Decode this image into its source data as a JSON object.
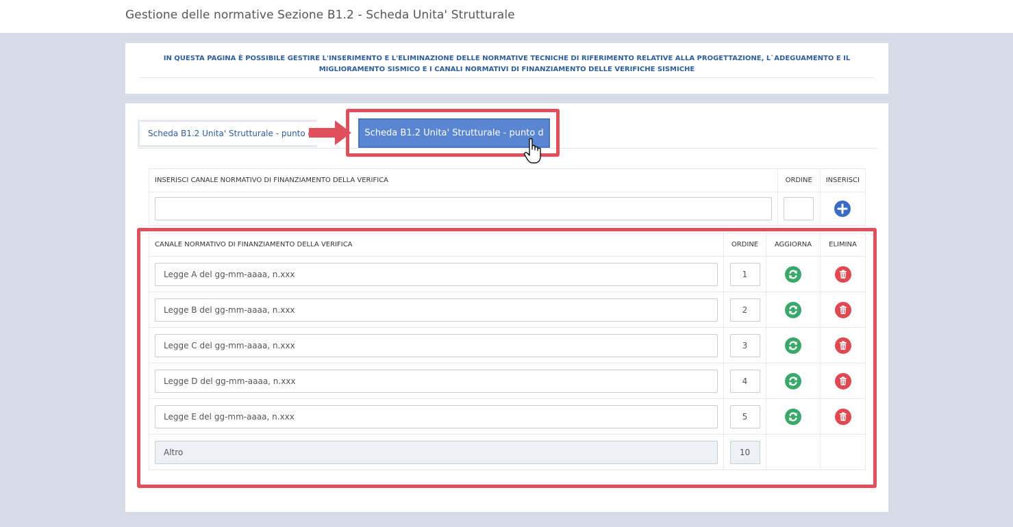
{
  "page_title": "Gestione delle normative Sezione B1.2 - Scheda Unita' Strutturale",
  "info_text": "IN QUESTA PAGINA È POSSIBILE GESTIRE L'INSERIMENTO E L'ELIMINAZIONE DELLE NORMATIVE TECNICHE DI RIFERIMENTO RELATIVE ALLA PROGETTAZIONE, L`ADEGUAMENTO E IL MIGLIORAMENTO SISMICO E I CANALI NORMATIVI DI FINANZIAMENTO DELLE VERIFICHE SISMICHE",
  "tabs": [
    {
      "label": "Scheda B1.2 Unita' Strutturale - punto c"
    },
    {
      "label": "Scheda B1.2 Unita' Strutturale - punto d",
      "active": true
    }
  ],
  "insert_table": {
    "headers": [
      "INSERISCI CANALE NORMATIVO DI FINANZIAMENTO DELLA VERIFICA",
      "ORDINE",
      "INSERISCI"
    ],
    "text_value": "",
    "order_value": ""
  },
  "list_table": {
    "headers": [
      "CANALE NORMATIVO DI FINANZIAMENTO DELLA VERIFICA",
      "ORDINE",
      "AGGIORNA",
      "ELIMINA"
    ],
    "rows": [
      {
        "name": "Legge A del gg-mm-aaaa, n.xxx",
        "order": "1"
      },
      {
        "name": "Legge B del gg-mm-aaaa, n.xxx",
        "order": "2"
      },
      {
        "name": "Legge C del gg-mm-aaaa, n.xxx",
        "order": "3"
      },
      {
        "name": "Legge D del gg-mm-aaaa, n.xxx",
        "order": "4"
      },
      {
        "name": "Legge E del gg-mm-aaaa, n.xxx",
        "order": "5"
      }
    ],
    "fixed_row": {
      "name": "Altro",
      "order": "10"
    }
  },
  "icons": {
    "insert": "plus-icon",
    "update": "refresh-icon",
    "delete": "trash-icon"
  },
  "colors": {
    "primary": "#3a6dc1",
    "active_tab": "#5a85d0",
    "update": "#3aa86b",
    "delete": "#e04852",
    "highlight": "#e0505c"
  }
}
